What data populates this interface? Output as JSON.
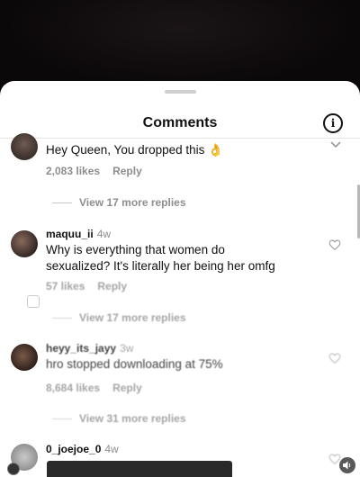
{
  "sheet": {
    "title": "Comments"
  },
  "comments": [
    {
      "text": "Hey Queen, You dropped this",
      "emoji": "👌",
      "likes": "2,083 likes",
      "reply_label": "Reply",
      "more_replies": "View 17 more replies"
    },
    {
      "username": "maquu_ii",
      "age": "4w",
      "text_line1": "Why is everything that women do",
      "text_line2": "sexualized? It's literally her being her omfg",
      "likes": "57 likes",
      "reply_label": "Reply",
      "more_replies": "View 17 more replies"
    },
    {
      "username": "heyy_its_jayy",
      "age": "3w",
      "text": "hro stopped downloading at 75%",
      "likes": "8,684 likes",
      "reply_label": "Reply",
      "more_replies": "View 31 more replies"
    },
    {
      "username": "0_joejoe_0",
      "age": "4w"
    }
  ],
  "icons": {
    "info": "info-icon",
    "heart": "heart-outline-icon",
    "chevron": "chevron-down-icon",
    "sound": "speaker-icon"
  },
  "colors": {
    "sheet_bg": "#ffffff",
    "secondary_text": "#8e8e8e",
    "backdrop": "#0d0a0b"
  }
}
